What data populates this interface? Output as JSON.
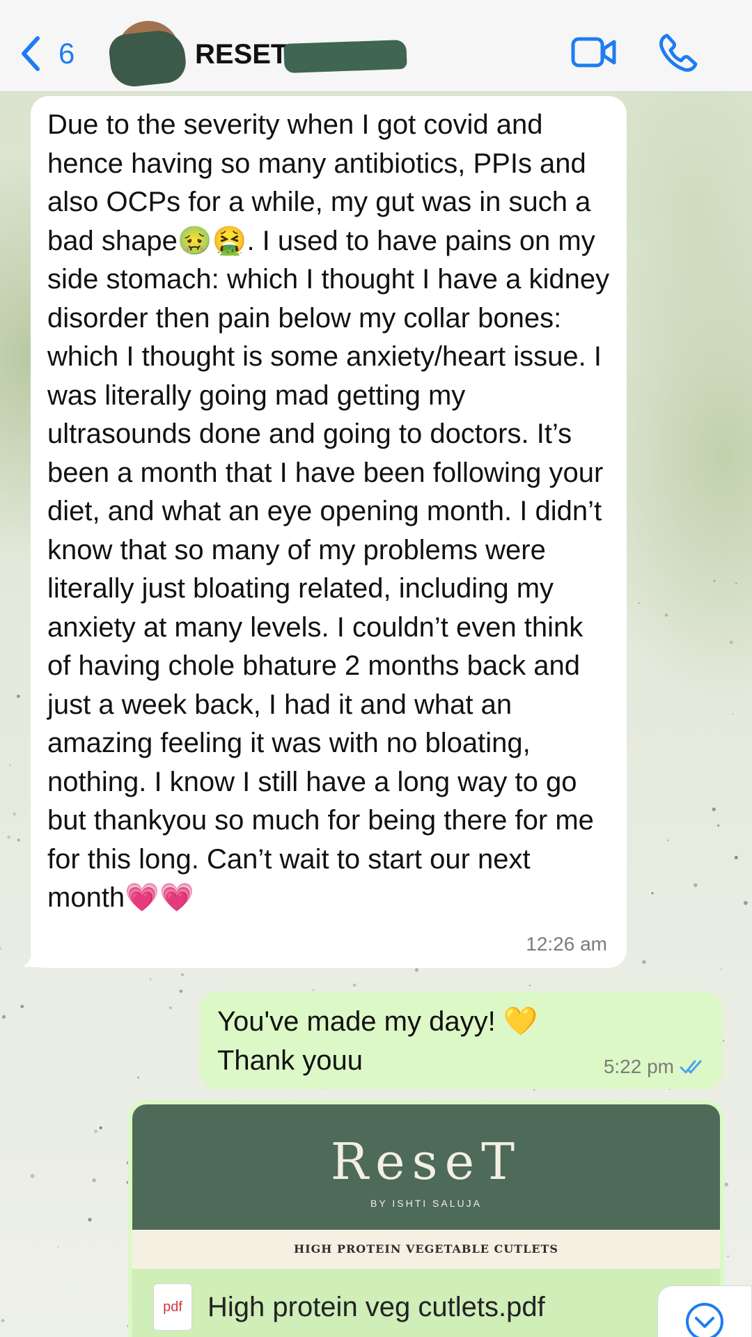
{
  "header": {
    "back_count": "6",
    "chat_title": "RESET V",
    "icons": [
      "chevron-left-icon",
      "video-call-icon",
      "phone-icon"
    ],
    "accent_color": "#1e7cf2"
  },
  "messages": [
    {
      "direction": "incoming",
      "text": "Due to the severity when I got covid and hence having so many antibiotics, PPIs and also OCPs for a while, my gut was in such a bad shape🤢🤮. I used to have pains on my side stomach: which I thought I have a kidney disorder then pain below my collar bones: which I thought is some anxiety/heart issue. I was literally going mad getting my ultrasounds done and going to doctors. It’s been a month that I have been following your diet, and what an eye opening month. I didn’t know that so many of my problems were literally just bloating related, including my anxiety at many levels. I couldn’t even think of having chole bhature 2 months back and just a week back, I had it and what an amazing feeling it was with no bloating, nothing. I know I still have a long way to go but thankyou so much for being there for me for this long. Can’t wait to start our next month💗💗",
      "time": "12:26 am"
    },
    {
      "direction": "outgoing",
      "text_line1": "You've made my dayy! 💛",
      "text_line2": "Thank youu",
      "time": "5:22 pm",
      "status": "read"
    },
    {
      "direction": "outgoing",
      "type": "document",
      "preview_brand": "ReseT",
      "preview_subtitle": "BY ISHTI SALUJA",
      "preview_heading": "HIGH PROTEIN VEGETABLE CUTLETS",
      "file_type": "pdf",
      "file_name": "High protein veg cutlets.pdf"
    }
  ],
  "colors": {
    "incoming_bubble": "#ffffff",
    "outgoing_bubble": "#dcf8c6",
    "brand_green": "#4e6a59",
    "read_tick": "#4aa3f0"
  }
}
